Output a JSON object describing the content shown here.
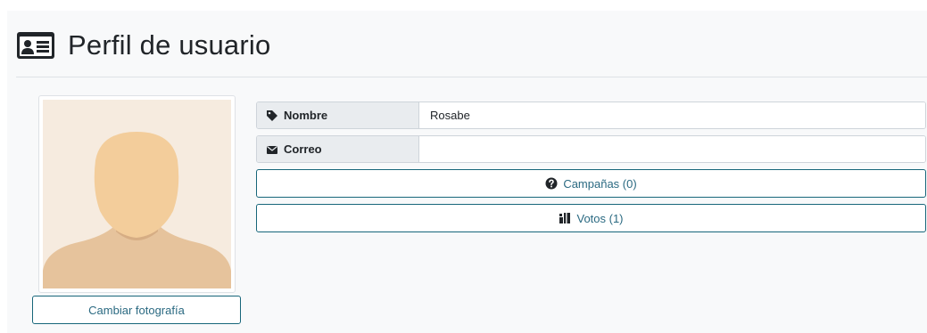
{
  "header": {
    "title": "Perfil de usuario",
    "icon": "id-card-icon"
  },
  "profile": {
    "avatar_icon": "default-avatar-silhouette",
    "change_photo_label": "Cambiar fotografía"
  },
  "fields": {
    "nombre": {
      "label": "Nombre",
      "icon": "tag-icon",
      "value": "Rosabe"
    },
    "correo": {
      "label": "Correo",
      "icon": "envelope-icon",
      "value": ""
    }
  },
  "actions": {
    "campanas_label": "Campañas (0)",
    "campanas_icon": "question-circle-icon",
    "votos_label": "Votos (1)",
    "votos_icon": "ballot-box-icon"
  },
  "colors": {
    "accent": "#17667a",
    "accent_text": "#2b6a82",
    "panel_bg": "#f8f9fa",
    "label_bg": "#e9ecef"
  }
}
